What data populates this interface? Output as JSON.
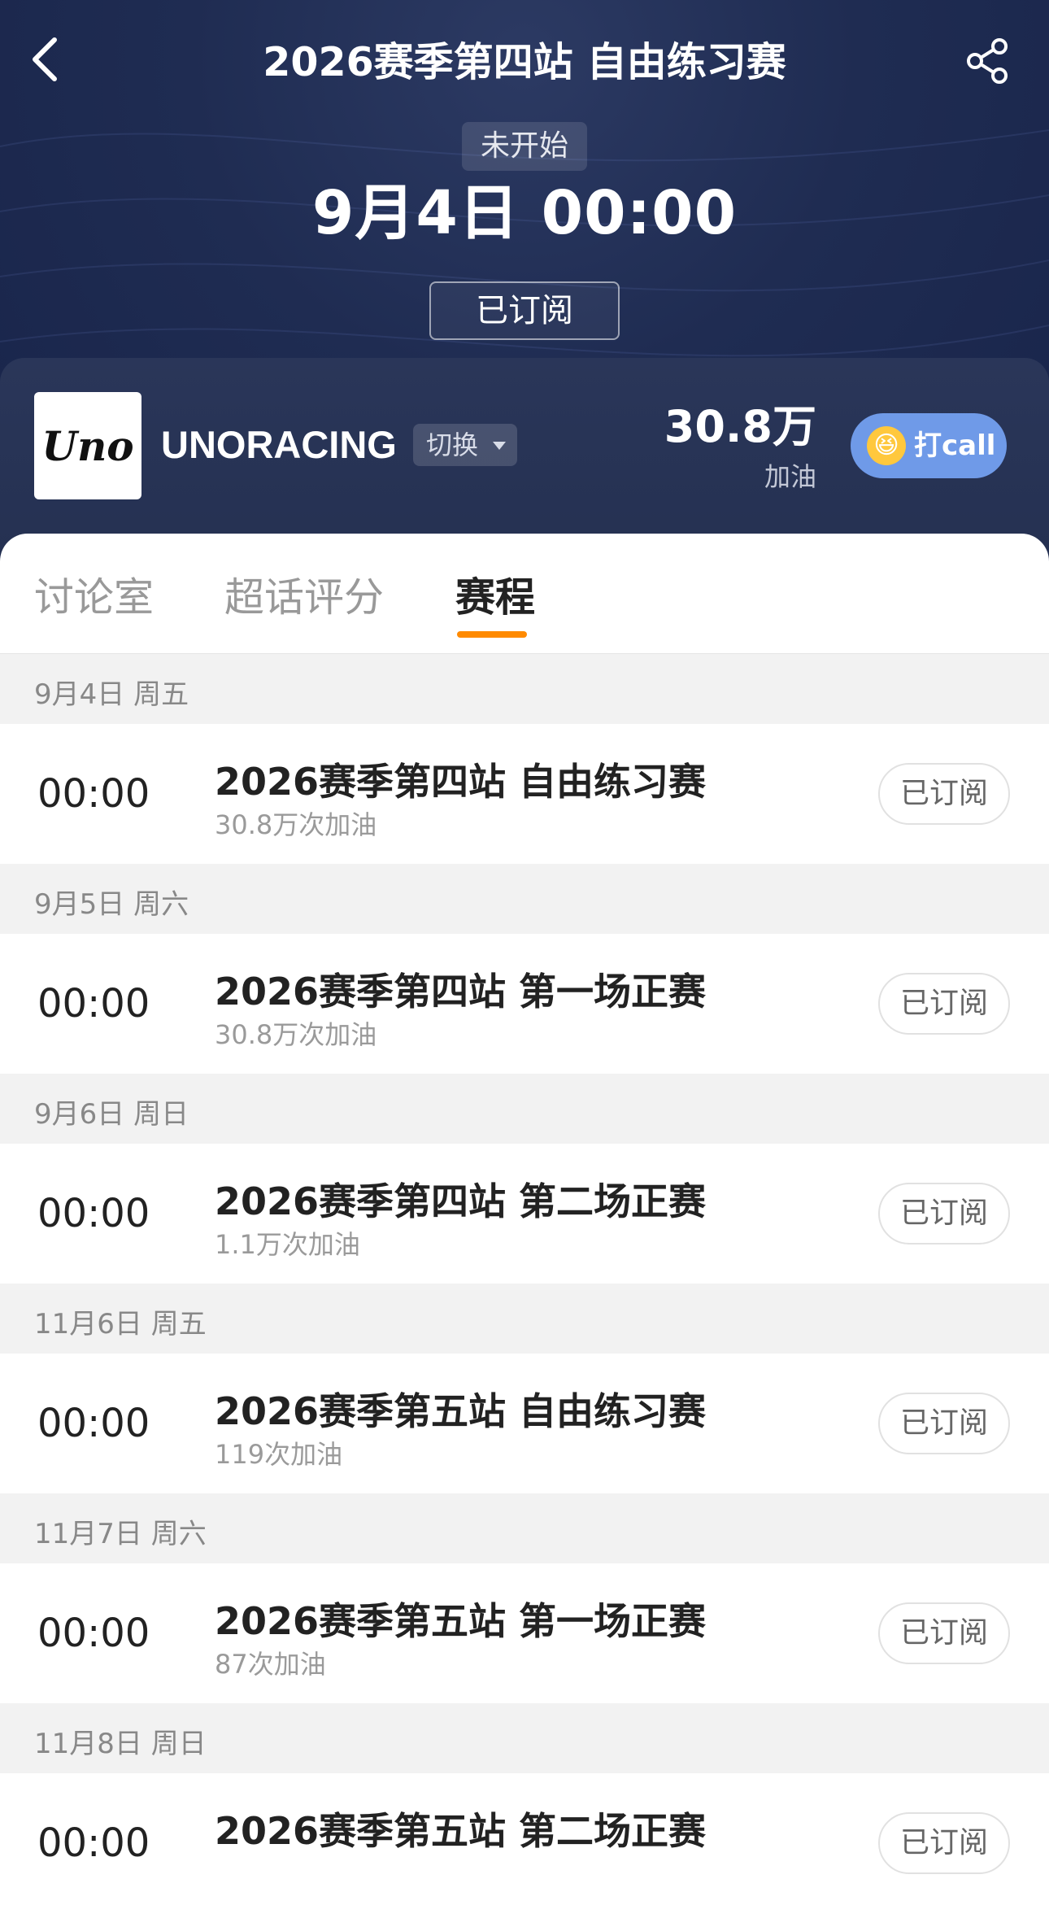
{
  "header": {
    "title": "2026赛季第四站 自由练习赛",
    "status": "未开始",
    "datetime": "9月4日 00:00",
    "subscribe_label": "已订阅"
  },
  "team": {
    "logo_text": "Uno",
    "name": "UNORACING",
    "switch_label": "切换",
    "cheer_count": "30.8万",
    "cheer_label": "加油",
    "call_label": "打call"
  },
  "tabs": [
    {
      "label": "讨论室",
      "active": false
    },
    {
      "label": "超话评分",
      "active": false
    },
    {
      "label": "赛程",
      "active": true
    }
  ],
  "schedule": [
    {
      "date": "9月4日 周五",
      "time": "00:00",
      "title": "2026赛季第四站 自由练习赛",
      "cheers": "30.8万次加油",
      "button": "已订阅"
    },
    {
      "date": "9月5日 周六",
      "time": "00:00",
      "title": "2026赛季第四站 第一场正赛",
      "cheers": "30.8万次加油",
      "button": "已订阅"
    },
    {
      "date": "9月6日 周日",
      "time": "00:00",
      "title": "2026赛季第四站 第二场正赛",
      "cheers": "1.1万次加油",
      "button": "已订阅"
    },
    {
      "date": "11月6日 周五",
      "time": "00:00",
      "title": "2026赛季第五站 自由练习赛",
      "cheers": "119次加油",
      "button": "已订阅"
    },
    {
      "date": "11月7日 周六",
      "time": "00:00",
      "title": "2026赛季第五站 第一场正赛",
      "cheers": "87次加油",
      "button": "已订阅"
    },
    {
      "date": "11月8日 周日",
      "time": "00:00",
      "title": "2026赛季第五站 第二场正赛",
      "cheers": "",
      "button": "已订阅"
    }
  ],
  "colors": {
    "header_bg": "#1f2c52",
    "accent_tab": "#ff8a00",
    "call_button": "#6f9ae8"
  },
  "icons": {
    "back": "chevron-left-icon",
    "share": "share-icon",
    "call_emoji": "excited-face-icon"
  }
}
